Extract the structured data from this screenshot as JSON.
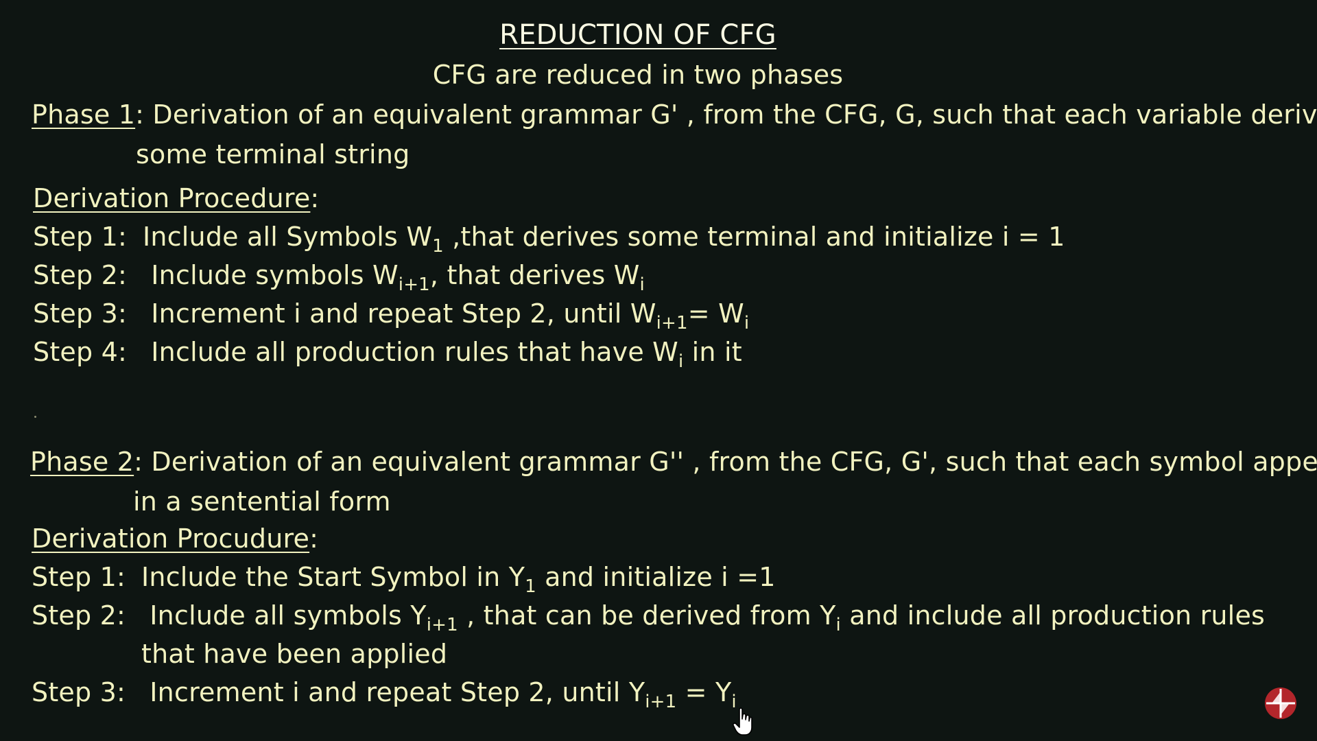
{
  "title": "REDUCTION OF CFG",
  "subtitle": "CFG are reduced in two phases",
  "phase1": {
    "label": "Phase 1",
    "colon": ":",
    "desc_line1": " Derivation of an equivalent grammar G' , from the CFG,  G, such that each variable derives",
    "desc_line2": "some terminal string",
    "procedure_heading": "Derivation Procedure",
    "steps": [
      {
        "label": "Step 1:",
        "pre": "Include all Symbols W",
        "sub": "1",
        "post": " ,that derives some terminal and initialize i = 1"
      },
      {
        "label": "Step 2:",
        "pre": " Include symbols W",
        "sub": "i+1",
        "mid": ", that derives W",
        "sub2": "i"
      },
      {
        "label": "Step 3:",
        "pre": " Increment i and repeat Step 2, until W",
        "sub": "i+1",
        "mid": "= W",
        "sub2": "i"
      },
      {
        "label": "Step 4:",
        "pre": "  Include all production rules that have W",
        "sub": "i",
        "post": " in it"
      }
    ]
  },
  "phase2": {
    "label": "Phase 2",
    "colon": ":",
    "desc_line1": " Derivation of an equivalent grammar G''  ,  from the CFG,  G', such that each symbol appears",
    "desc_line2": "in a sentential form",
    "procedure_heading": "Derivation Procudure",
    "steps": [
      {
        "label": "Step 1:",
        "pre": "Include the Start Symbol in Y",
        "sub": "1",
        "post": " and initialize i =1"
      },
      {
        "label": "Step 2:",
        "pre": " Include all symbols Y",
        "sub": "i+1",
        "mid": " , that can be derived from Y",
        "sub2": "i",
        "post": "   and include all production rules"
      },
      {
        "continuation": "that have been applied"
      },
      {
        "label": "Step 3:",
        "pre": " Increment i and repeat Step 2, until Y",
        "sub": "i+1",
        "mid": " = Y",
        "sub2": "i"
      }
    ]
  },
  "colors": {
    "background": "#0e1512",
    "chalk_text": "#f2f2c0",
    "logo_red": "#b3262b"
  },
  "icons": [
    "logo-icon",
    "hand-cursor-icon"
  ]
}
